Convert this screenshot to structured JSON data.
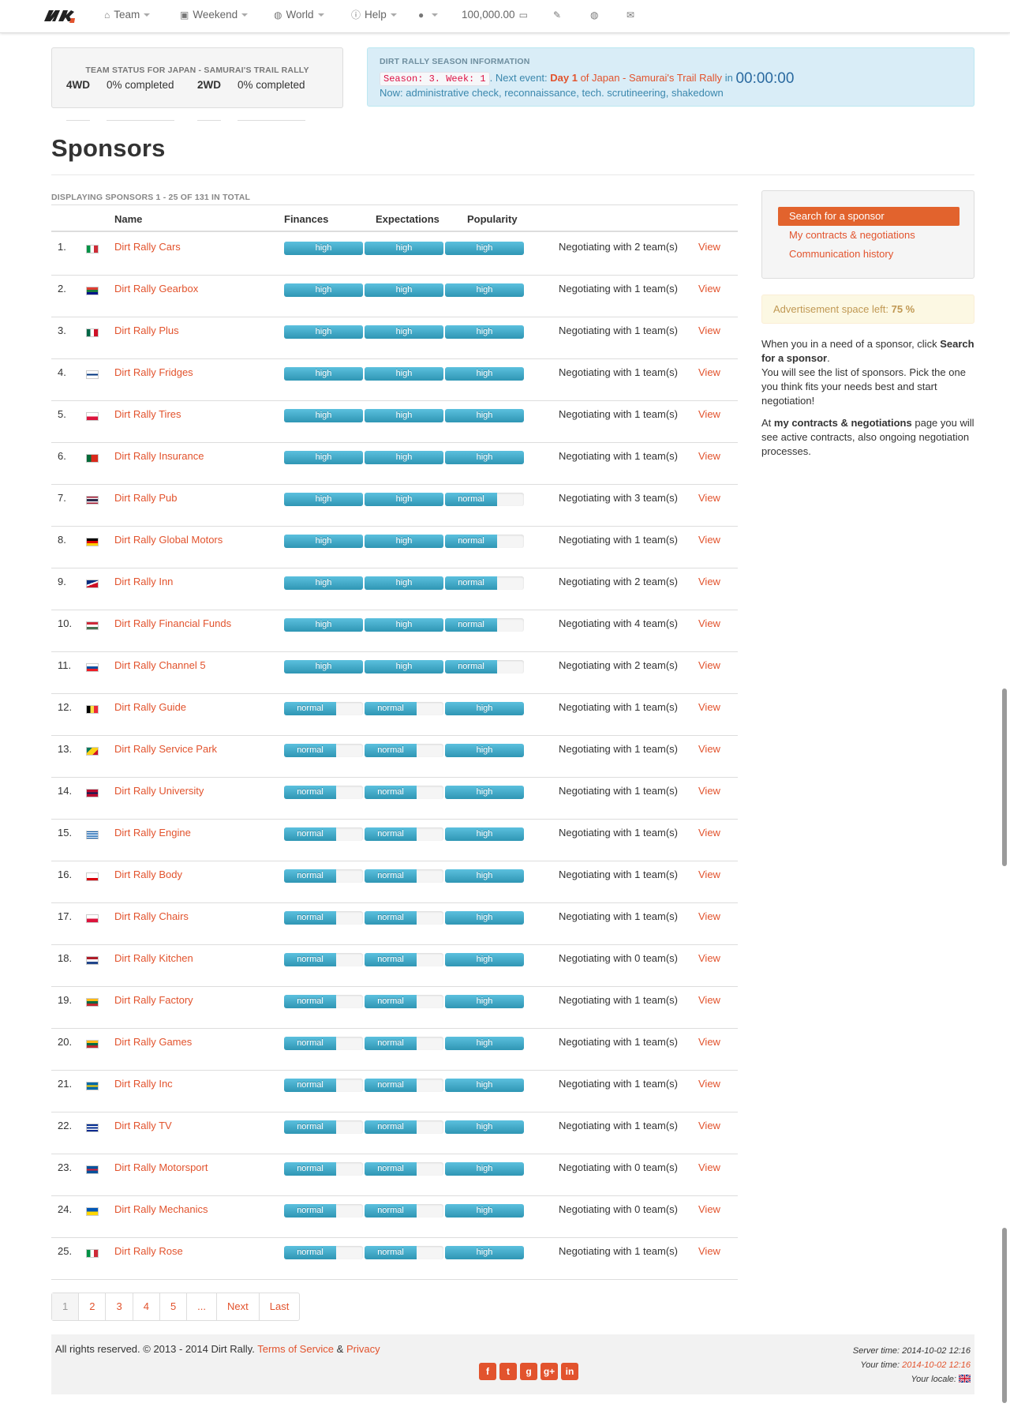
{
  "nav": {
    "items": [
      {
        "label": "Team",
        "icon": "home-icon",
        "caret": true
      },
      {
        "label": "Weekend",
        "icon": "picture-icon",
        "caret": true
      },
      {
        "label": "World",
        "icon": "globe-icon",
        "caret": true
      },
      {
        "label": "Help",
        "icon": "info-icon",
        "caret": true
      },
      {
        "label": "",
        "icon": "user-icon",
        "caret": true
      },
      {
        "label": "100,000.00",
        "icon": "money-icon",
        "caret": false
      },
      {
        "label": "",
        "icon": "edit-icon",
        "caret": false
      },
      {
        "label": "",
        "icon": "globe-icon",
        "caret": false
      },
      {
        "label": "",
        "icon": "envelope-icon",
        "caret": false
      }
    ]
  },
  "team_status": {
    "heading": "TEAM STATUS FOR JAPAN - SAMURAI'S TRAIL RALLY",
    "wd4_label": "4WD",
    "wd4_value": "0% completed",
    "wd2_label": "2WD",
    "wd2_value": "0% completed"
  },
  "season_info": {
    "heading": "DIRT RALLY SEASON INFORMATION",
    "season_code": "Season: 3. Week: 1",
    "next_event_prefix": ". Next event:",
    "day": "Day 1",
    "event_of": "of Japan - Samurai's Trail Rally",
    "in": "in",
    "countdown": "00:00:00",
    "now": "Now: administrative check, reconnaissance, tech. scrutineering, shakedown"
  },
  "page_title": "Sponsors",
  "displaying": "DISPLAYING SPONSORS 1 - 25 OF 131 IN TOTAL",
  "table": {
    "headers": {
      "name": "Name",
      "finances": "Finances",
      "expectations": "Expectations",
      "popularity": "Popularity"
    },
    "view_label": "View",
    "rows": [
      {
        "num": "1.",
        "flag": "flag-italy",
        "name": "Dirt Rally Cars",
        "fin": "high",
        "exp": "high",
        "pop": "high",
        "note": "Negotiating with 2 team(s)"
      },
      {
        "num": "2.",
        "flag": "flag-south-africa",
        "name": "Dirt Rally Gearbox",
        "fin": "high",
        "exp": "high",
        "pop": "high",
        "note": "Negotiating with 1 team(s)"
      },
      {
        "num": "3.",
        "flag": "flag-mexico",
        "name": "Dirt Rally Plus",
        "fin": "high",
        "exp": "high",
        "pop": "high",
        "note": "Negotiating with 1 team(s)"
      },
      {
        "num": "4.",
        "flag": "flag-finland",
        "name": "Dirt Rally Fridges",
        "fin": "high",
        "exp": "high",
        "pop": "high",
        "note": "Negotiating with 1 team(s)"
      },
      {
        "num": "5.",
        "flag": "flag-poland",
        "name": "Dirt Rally Tires",
        "fin": "high",
        "exp": "high",
        "pop": "high",
        "note": "Negotiating with 1 team(s)"
      },
      {
        "num": "6.",
        "flag": "flag-portugal",
        "name": "Dirt Rally Insurance",
        "fin": "high",
        "exp": "high",
        "pop": "high",
        "note": "Negotiating with 1 team(s)"
      },
      {
        "num": "7.",
        "flag": "flag-thailand",
        "name": "Dirt Rally Pub",
        "fin": "high",
        "exp": "high",
        "pop": "normal",
        "note": "Negotiating with 3 team(s)"
      },
      {
        "num": "8.",
        "flag": "flag-germany",
        "name": "Dirt Rally Global Motors",
        "fin": "high",
        "exp": "high",
        "pop": "normal",
        "note": "Negotiating with 1 team(s)"
      },
      {
        "num": "9.",
        "flag": "flag-american-samoa",
        "name": "Dirt Rally Inn",
        "fin": "high",
        "exp": "high",
        "pop": "normal",
        "note": "Negotiating with 2 team(s)"
      },
      {
        "num": "10.",
        "flag": "flag-hungary",
        "name": "Dirt Rally Financial Funds",
        "fin": "high",
        "exp": "high",
        "pop": "normal",
        "note": "Negotiating with 4 team(s)"
      },
      {
        "num": "11.",
        "flag": "flag-slovakia",
        "name": "Dirt Rally Channel 5",
        "fin": "high",
        "exp": "high",
        "pop": "normal",
        "note": "Negotiating with 2 team(s)"
      },
      {
        "num": "12.",
        "flag": "flag-belgium",
        "name": "Dirt Rally Guide",
        "fin": "normal",
        "exp": "normal",
        "pop": "high",
        "note": "Negotiating with 1 team(s)"
      },
      {
        "num": "13.",
        "flag": "flag-grenada",
        "name": "Dirt Rally Service Park",
        "fin": "normal",
        "exp": "normal",
        "pop": "high",
        "note": "Negotiating with 1 team(s)"
      },
      {
        "num": "14.",
        "flag": "flag-norway",
        "name": "Dirt Rally University",
        "fin": "normal",
        "exp": "normal",
        "pop": "high",
        "note": "Negotiating with 1 team(s)"
      },
      {
        "num": "15.",
        "flag": "flag-greece",
        "name": "Dirt Rally Engine",
        "fin": "normal",
        "exp": "normal",
        "pop": "high",
        "note": "Negotiating with 1 team(s)"
      },
      {
        "num": "16.",
        "flag": "flag-gibraltar",
        "name": "Dirt Rally Body",
        "fin": "normal",
        "exp": "normal",
        "pop": "high",
        "note": "Negotiating with 1 team(s)"
      },
      {
        "num": "17.",
        "flag": "flag-poland",
        "name": "Dirt Rally Chairs",
        "fin": "normal",
        "exp": "normal",
        "pop": "high",
        "note": "Negotiating with 1 team(s)"
      },
      {
        "num": "18.",
        "flag": "flag-netherlands",
        "name": "Dirt Rally Kitchen",
        "fin": "normal",
        "exp": "normal",
        "pop": "high",
        "note": "Negotiating with 0 team(s)"
      },
      {
        "num": "19.",
        "flag": "flag-lithuania",
        "name": "Dirt Rally Factory",
        "fin": "normal",
        "exp": "normal",
        "pop": "high",
        "note": "Negotiating with 1 team(s)"
      },
      {
        "num": "20.",
        "flag": "flag-lithuania",
        "name": "Dirt Rally Games",
        "fin": "normal",
        "exp": "normal",
        "pop": "high",
        "note": "Negotiating with 1 team(s)"
      },
      {
        "num": "21.",
        "flag": "flag-sweden",
        "name": "Dirt Rally Inc",
        "fin": "normal",
        "exp": "normal",
        "pop": "high",
        "note": "Negotiating with 1 team(s)"
      },
      {
        "num": "22.",
        "flag": "flag-cuba",
        "name": "Dirt Rally TV",
        "fin": "normal",
        "exp": "normal",
        "pop": "high",
        "note": "Negotiating with 1 team(s)"
      },
      {
        "num": "23.",
        "flag": "flag-iceland",
        "name": "Dirt Rally Motorsport",
        "fin": "normal",
        "exp": "normal",
        "pop": "high",
        "note": "Negotiating with 0 team(s)"
      },
      {
        "num": "24.",
        "flag": "flag-ukraine",
        "name": "Dirt Rally Mechanics",
        "fin": "normal",
        "exp": "normal",
        "pop": "high",
        "note": "Negotiating with 0 team(s)"
      },
      {
        "num": "25.",
        "flag": "flag-italy",
        "name": "Dirt Rally Rose",
        "fin": "normal",
        "exp": "normal",
        "pop": "high",
        "note": "Negotiating with 1 team(s)"
      }
    ]
  },
  "level_fill": {
    "high": 1.0,
    "normal": 0.66
  },
  "pagination": [
    "1",
    "2",
    "3",
    "4",
    "5",
    "...",
    "Next",
    "Last"
  ],
  "sidebar": {
    "links": [
      "Search for a sponsor",
      "My contracts & negotiations",
      "Communication history"
    ],
    "ad_label": "Advertisement space left:",
    "ad_value": "75 %",
    "help1_a": "When you in a need of a sponsor, click",
    "help1_b": "Search for a sponsor",
    "help1_c": ".",
    "help1_d": "You will see the list of sponsors. Pick the one you think fits your needs best and start negotiation!",
    "help2_a": "At",
    "help2_b": "my contracts & negotiations",
    "help2_c": "page you will see active contracts, also ongoing negotiation processes."
  },
  "footer": {
    "copyright": "All rights reserved. © 2013 - 2014 Dirt Rally.",
    "terms": "Terms of Service",
    "amp": "&",
    "privacy": "Privacy",
    "server_label": "Server time:",
    "server_time": "2014-10-02 12:16",
    "your_label": "Your time:",
    "your_time": "2014-10-02 12:16",
    "locale_label": "Your locale:"
  },
  "colors": {
    "accent": "#e2532d",
    "bar": "#2f96b4",
    "info_bg": "#d9edf7"
  }
}
